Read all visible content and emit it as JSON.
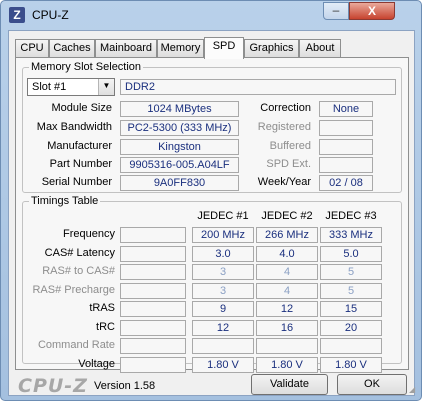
{
  "window": {
    "app_icon": "Z",
    "title": "CPU-Z",
    "minimize_symbol": "–",
    "close_symbol": "X"
  },
  "tabs": [
    "CPU",
    "Caches",
    "Mainboard",
    "Memory",
    "SPD",
    "Graphics",
    "About"
  ],
  "active_tab": "SPD",
  "memory_slot": {
    "group_title": "Memory Slot Selection",
    "slot_selected": "Slot #1",
    "memory_type": "DDR2",
    "module_size_label": "Module Size",
    "module_size": "1024 MBytes",
    "max_bandwidth_label": "Max Bandwidth",
    "max_bandwidth": "PC2-5300 (333 MHz)",
    "manufacturer_label": "Manufacturer",
    "manufacturer": "Kingston",
    "part_number_label": "Part Number",
    "part_number": "9905316-005.A04LF",
    "serial_number_label": "Serial Number",
    "serial_number": "9A0FF830",
    "correction_label": "Correction",
    "correction": "None",
    "registered_label": "Registered",
    "registered": "",
    "buffered_label": "Buffered",
    "buffered": "",
    "spd_ext_label": "SPD Ext.",
    "spd_ext": "",
    "week_year_label": "Week/Year",
    "week_year": "02 / 08"
  },
  "timings": {
    "group_title": "Timings Table",
    "columns": [
      "JEDEC #1",
      "JEDEC #2",
      "JEDEC #3"
    ],
    "rows": [
      {
        "label": "Frequency",
        "dim": false,
        "values": [
          "200 MHz",
          "266 MHz",
          "333 MHz"
        ]
      },
      {
        "label": "CAS# Latency",
        "dim": false,
        "values": [
          "3.0",
          "4.0",
          "5.0"
        ]
      },
      {
        "label": "RAS# to CAS#",
        "dim": true,
        "values": [
          "3",
          "4",
          "5"
        ]
      },
      {
        "label": "RAS# Precharge",
        "dim": true,
        "values": [
          "3",
          "4",
          "5"
        ]
      },
      {
        "label": "tRAS",
        "dim": false,
        "values": [
          "9",
          "12",
          "15"
        ]
      },
      {
        "label": "tRC",
        "dim": false,
        "values": [
          "12",
          "16",
          "20"
        ]
      },
      {
        "label": "Command Rate",
        "dim": true,
        "values": [
          "",
          "",
          ""
        ]
      },
      {
        "label": "Voltage",
        "dim": false,
        "values": [
          "1.80 V",
          "1.80 V",
          "1.80 V"
        ]
      }
    ]
  },
  "footer": {
    "logo": "CPU-Z",
    "version": "Version 1.58",
    "validate_label": "Validate",
    "ok_label": "OK"
  }
}
